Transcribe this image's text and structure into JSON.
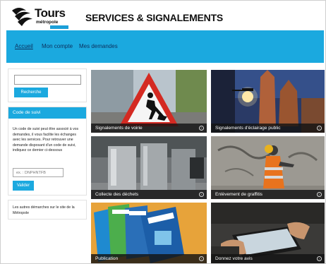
{
  "header": {
    "logo_brand": "Tours",
    "logo_sub": "métropole",
    "site_title": "SERVICES & SIGNALEMENTS"
  },
  "nav": {
    "items": [
      {
        "label": "Accueil",
        "active": true
      },
      {
        "label": "Mon compte",
        "active": false
      },
      {
        "label": "Mes demandes",
        "active": false
      }
    ]
  },
  "search": {
    "value": "",
    "button_label": "Recherche"
  },
  "code_suivi": {
    "heading": "Code de suivi",
    "description": "Un code de suivi peut être associé à vos demandes, il vous facilite les échanges avec les services. Pour retrouver une demande disposant d'un code de suivi, indiquez ce dernier ci-dessous",
    "input_placeholder": "ex. : DNPHNTFB",
    "button_label": "Valider"
  },
  "other_links": {
    "text": "Les autres démarches sur le site de la Métropole"
  },
  "tiles": [
    {
      "label": "Signalements de voirie"
    },
    {
      "label": "Signalements d'éclairage public"
    },
    {
      "label": "Collecte des déchets"
    },
    {
      "label": "Enlèvement de graffitis"
    },
    {
      "label": "Publication"
    },
    {
      "label": "Donnez votre avis"
    }
  ],
  "colors": {
    "accent": "#1ba9df",
    "nav_text": "#0c2f5c",
    "caption_bg": "#141414"
  }
}
